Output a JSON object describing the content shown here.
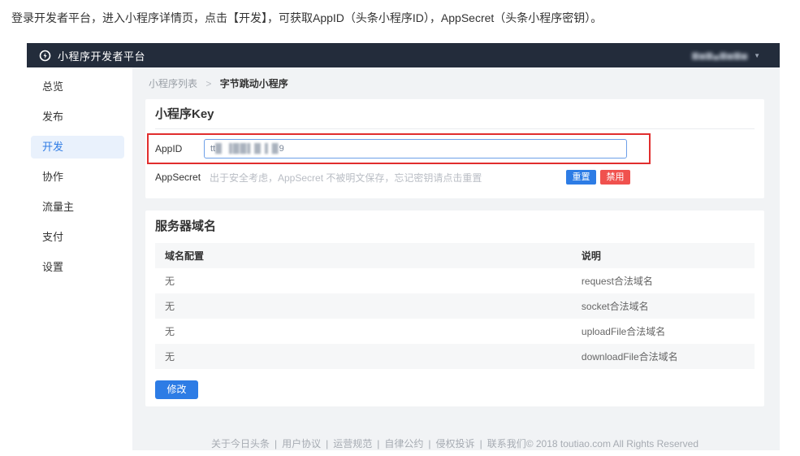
{
  "instruction": "登录开发者平台，进入小程序详情页，点击【开发】，可获取AppID（头条小程序ID），AppSecret（头条小程序密钥）。",
  "header": {
    "title": "小程序开发者平台",
    "username_masked": "▆▅▆▄▆▅▆▅",
    "caret": "▼"
  },
  "sidebar": {
    "items": [
      {
        "label": "总览"
      },
      {
        "label": "发布"
      },
      {
        "label": "开发"
      },
      {
        "label": "协作"
      },
      {
        "label": "流量主"
      },
      {
        "label": "支付"
      },
      {
        "label": "设置"
      }
    ]
  },
  "breadcrumb": {
    "parent": "小程序列表",
    "separator": ">",
    "current": "字节跳动小程序"
  },
  "key_section": {
    "title": "小程序Key",
    "appid": {
      "label": "AppID",
      "value_prefix": "tt",
      "value_masked": "█ ▐██▌█ ▌█",
      "value_suffix": "9"
    },
    "appsecret": {
      "label": "AppSecret",
      "placeholder": "出于安全考虑，AppSecret 不被明文保存，忘记密钥请点击重置",
      "reset_button": "重置",
      "disable_button": "禁用"
    }
  },
  "domain_section": {
    "title": "服务器域名",
    "table": {
      "headers": [
        "域名配置",
        "说明"
      ],
      "rows": [
        [
          "无",
          "request合法域名"
        ],
        [
          "无",
          "socket合法域名"
        ],
        [
          "无",
          "uploadFile合法域名"
        ],
        [
          "无",
          "downloadFile合法域名"
        ]
      ]
    },
    "modify_button": "修改"
  },
  "footer": {
    "links": [
      "关于今日头条",
      "用户协议",
      "运营规范",
      "自律公约",
      "侵权投诉",
      "联系我们"
    ],
    "separator": "|",
    "copyright": "© 2018 toutiao.com All Rights Reserved"
  },
  "colors": {
    "header_bg": "#232c3b",
    "accent_blue": "#2d7ce5",
    "danger_red": "#f0514e",
    "annotation_red": "#e12e2e",
    "content_bg": "#f1f3f5",
    "active_item_bg": "#e9f1fc"
  }
}
